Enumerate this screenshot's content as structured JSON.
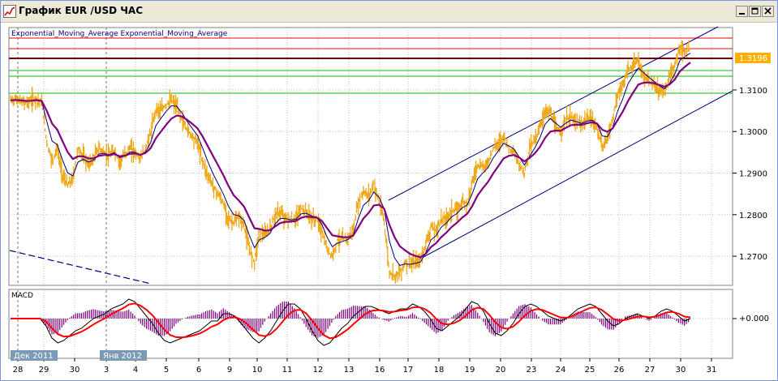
{
  "window": {
    "title": "График EUR /USD ЧАС",
    "icon": "chart-window-icon",
    "buttons": [
      "minimize-icon",
      "restore-icon",
      "close-icon"
    ]
  },
  "main_chart": {
    "indicator_label": "Exponential_Moving_Average Exponential_Moving_Average",
    "current_price": "1.3196",
    "price_label_color": "#ffb000",
    "price_ticks": [
      "1.3100",
      "1.3000",
      "1.2900",
      "1.2800",
      "1.2700"
    ]
  },
  "macd_panel": {
    "label": "MACD",
    "zero_label": "+0.000"
  },
  "time_axis": {
    "day_ticks": [
      "28",
      "29",
      "30",
      "3",
      "4",
      "5",
      "6",
      "9",
      "10",
      "11",
      "12",
      "13",
      "16",
      "17",
      "18",
      "19",
      "20",
      "23",
      "24",
      "25",
      "26",
      "27",
      "30",
      "31"
    ],
    "month_labels": [
      "Дек 2011",
      "Янв 2012"
    ]
  },
  "colors": {
    "price_bars": "#f0a818",
    "ema_fast": "#000080",
    "ema_slow": "#800080",
    "channel": "#000080",
    "resistance_red": "#ff0000",
    "resistance_dark": "#800000",
    "support_green": "#00c000",
    "macd_signal": "#ff0000",
    "macd_histogram": "#800080",
    "grid": "#c0c0c0",
    "month_label_bg": "#7b9ab5"
  },
  "chart_data": [
    {
      "type": "line",
      "y_ticks": [
        "1.3100",
        "1.3000",
        "1.2900",
        "1.2800",
        "1.2700"
      ],
      "ylim": [
        1.263,
        1.325
      ],
      "series": [
        {
          "values": [
            1.3075,
            1.3078,
            1.3072,
            1.307,
            1.3075,
            1.308,
            1.3068,
            1.2975,
            1.293,
            1.296,
            1.2895,
            1.287,
            1.2885,
            1.296,
            1.294,
            1.292,
            1.2935,
            1.296,
            1.295,
            1.294,
            1.2955,
            1.2925,
            1.2945,
            1.296,
            1.295,
            1.2935,
            1.296,
            1.2995,
            1.3055,
            1.305,
            1.3065,
            1.3075,
            1.306,
            1.303,
            1.3005,
            1.299,
            1.2975,
            1.293,
            1.2895,
            1.287,
            1.285,
            1.2825,
            1.279,
            1.278,
            1.2795,
            1.2775,
            1.2715,
            1.269,
            1.276,
            1.275,
            1.2765,
            1.28,
            1.2805,
            1.279,
            1.2785,
            1.279,
            1.2815,
            1.2805,
            1.279,
            1.279,
            1.276,
            1.2715,
            1.27,
            1.274,
            1.274,
            1.2745,
            1.276,
            1.283,
            1.2855,
            1.2845,
            1.2875,
            1.283,
            1.2785,
            1.266,
            1.2655,
            1.266,
            1.2685,
            1.268,
            1.2685,
            1.269,
            1.273,
            1.277,
            1.276,
            1.279,
            1.279,
            1.281,
            1.281,
            1.283,
            1.283,
            1.288,
            1.292,
            1.2915,
            1.2925,
            1.296,
            1.297,
            1.299,
            1.296,
            1.295,
            1.292,
            1.29,
            1.296,
            1.298,
            1.301,
            1.305,
            1.3045,
            1.301,
            1.3,
            1.303,
            1.3035,
            1.302,
            1.3015,
            1.303,
            1.303,
            1.301,
            1.296,
            1.2985,
            1.303,
            1.309,
            1.311,
            1.315,
            1.3155,
            1.317,
            1.313,
            1.312,
            1.311,
            1.31,
            1.3095,
            1.313,
            1.316,
            1.3205,
            1.319,
            1.3196
          ]
        }
      ]
    },
    {
      "type": "line",
      "series": [
        {
          "values": [
            0,
            0,
            0,
            0,
            0,
            0,
            -0.3,
            -0.8,
            -1.0,
            -0.9,
            -0.7,
            -0.5,
            -0.4,
            -0.2,
            0.0,
            0.1,
            0.2,
            0.4,
            0.5,
            0.6,
            0.8,
            0.7,
            0.4,
            0.1,
            -0.2,
            -0.6,
            -0.9,
            -1.0,
            -0.9,
            -0.8,
            -0.7,
            -0.6,
            -0.5,
            -0.3,
            -0.1,
            -0.1,
            0.2,
            0.2,
            0.1,
            -0.2,
            -0.5,
            -0.8,
            -1.0,
            -0.8,
            -0.5,
            -0.1,
            0.3,
            0.6,
            0.6,
            0.4,
            0.0,
            -0.5,
            -0.9,
            -1.1,
            -1.0,
            -0.7,
            -0.4,
            -0.2,
            0.1,
            0.3,
            0.5,
            0.5,
            0.4,
            0.3,
            0.2,
            0.3,
            0.4,
            0.4,
            0.6,
            0.5,
            0.3,
            0.0,
            -0.4,
            -0.5,
            -0.3,
            -0.1,
            0.1,
            0.4,
            0.7,
            0.6,
            0.3,
            -0.2,
            -0.6,
            -0.7,
            -0.5,
            -0.2,
            0.2,
            0.5,
            0.6,
            0.5,
            0.3,
            0.1,
            0.0,
            -0.1,
            0.0,
            0.2,
            0.4,
            0.5,
            0.6,
            0.5,
            0.2,
            -0.1,
            -0.3,
            -0.2,
            0.0,
            0.1,
            0.2,
            0.1,
            0.0,
            0.1,
            0.3,
            0.4,
            0.3,
            0.1,
            -0.1,
            0.0
          ]
        }
      ]
    }
  ]
}
